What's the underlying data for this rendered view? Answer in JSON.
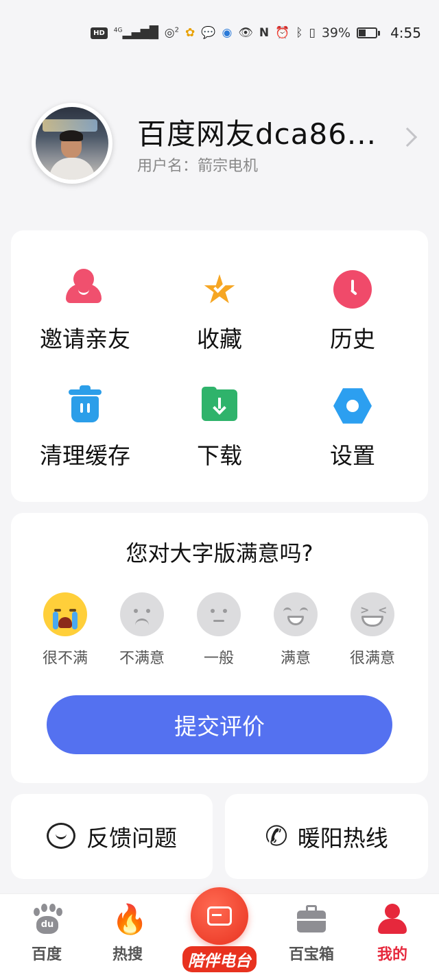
{
  "status_bar": {
    "hd": "HD",
    "network": "4G",
    "hotspot_count": "2",
    "battery": "39%",
    "time": "4:55"
  },
  "profile": {
    "display_name": "百度网友dca86...",
    "username_line": "用户名：箭宗电机"
  },
  "shortcuts": [
    {
      "label": "邀请亲友",
      "icon": "invite-icon",
      "color": "#f0506e"
    },
    {
      "label": "收藏",
      "icon": "star-check-icon",
      "color": "#f6a623"
    },
    {
      "label": "历史",
      "icon": "clock-icon",
      "color": "#f04a6a"
    },
    {
      "label": "清理缓存",
      "icon": "trash-icon",
      "color": "#2b9ee9"
    },
    {
      "label": "下载",
      "icon": "download-folder-icon",
      "color": "#2fb36b"
    },
    {
      "label": "设置",
      "icon": "settings-icon",
      "color": "#2c9ff0"
    }
  ],
  "survey": {
    "question": "您对大字版满意吗?",
    "options": [
      {
        "label": "很不满",
        "icon": "crying-face-icon"
      },
      {
        "label": "不满意",
        "icon": "frown-face-icon"
      },
      {
        "label": "一般",
        "icon": "neutral-face-icon"
      },
      {
        "label": "满意",
        "icon": "smile-face-icon"
      },
      {
        "label": "很满意",
        "icon": "laughing-face-icon"
      }
    ],
    "submit_label": "提交评价"
  },
  "actions": {
    "feedback_label": "反馈问题",
    "hotline_label": "暖阳热线"
  },
  "tabbar": {
    "items": [
      {
        "label": "百度",
        "icon": "baidu-paw-icon"
      },
      {
        "label": "热搜",
        "icon": "flame-icon"
      },
      {
        "label": "陪伴电台",
        "icon": "radio-icon"
      },
      {
        "label": "百宝箱",
        "icon": "toolbox-icon"
      },
      {
        "label": "我的",
        "icon": "user-icon"
      }
    ],
    "active_index": 4,
    "active_color": "#e6283c"
  },
  "colors": {
    "accent": "#5471f0",
    "background": "#f5f5f7"
  }
}
